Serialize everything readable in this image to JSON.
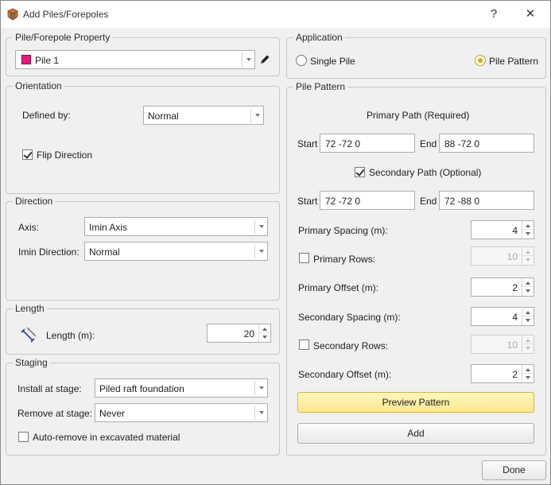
{
  "window": {
    "title": "Add Piles/Forepoles",
    "help_label": "?",
    "close_label": "✕"
  },
  "pile_property": {
    "group_label": "Pile/Forepole Property",
    "selected": "Pile 1",
    "swatch_color": "#e8197d"
  },
  "orientation": {
    "group_label": "Orientation",
    "defined_by_label": "Defined by:",
    "defined_by_value": "Normal",
    "flip_label": "Flip Direction",
    "flip_checked": true
  },
  "direction": {
    "group_label": "Direction",
    "axis_label": "Axis:",
    "axis_value": "Imin Axis",
    "imin_label": "Imin Direction:",
    "imin_value": "Normal"
  },
  "length": {
    "group_label": "Length",
    "label": "Length (m):",
    "value": "20"
  },
  "staging": {
    "group_label": "Staging",
    "install_label": "Install at stage:",
    "install_value": "Piled raft foundation",
    "remove_label": "Remove at stage:",
    "remove_value": "Never",
    "auto_remove_label": "Auto-remove in excavated material",
    "auto_remove_checked": false
  },
  "application": {
    "group_label": "Application",
    "single_label": "Single Pile",
    "pattern_label": "Pile Pattern",
    "selected": "pattern"
  },
  "pattern": {
    "group_label": "Pile Pattern",
    "primary_path_label": "Primary Path (Required)",
    "start_label": "Start",
    "end_label": "End",
    "primary_start": "72 -72 0",
    "primary_end": "88 -72 0",
    "secondary_path_label": "Secondary Path (Optional)",
    "secondary_checked": true,
    "secondary_start": "72 -72 0",
    "secondary_end": "72 -88 0",
    "primary_spacing_label": "Primary Spacing (m):",
    "primary_spacing": "4",
    "primary_rows_label": "Primary Rows:",
    "primary_rows": "10",
    "primary_rows_checked": false,
    "primary_offset_label": "Primary Offset (m):",
    "primary_offset": "2",
    "secondary_spacing_label": "Secondary Spacing (m):",
    "secondary_spacing": "4",
    "secondary_rows_label": "Secondary Rows:",
    "secondary_rows": "10",
    "secondary_rows_checked": false,
    "secondary_offset_label": "Secondary Offset (m):",
    "secondary_offset": "2",
    "preview_label": "Preview Pattern",
    "add_label": "Add"
  },
  "footer": {
    "done_label": "Done"
  },
  "icons": {
    "app": "pile-app-icon",
    "edit": "pencil-icon",
    "length": "length-measure-icon"
  }
}
